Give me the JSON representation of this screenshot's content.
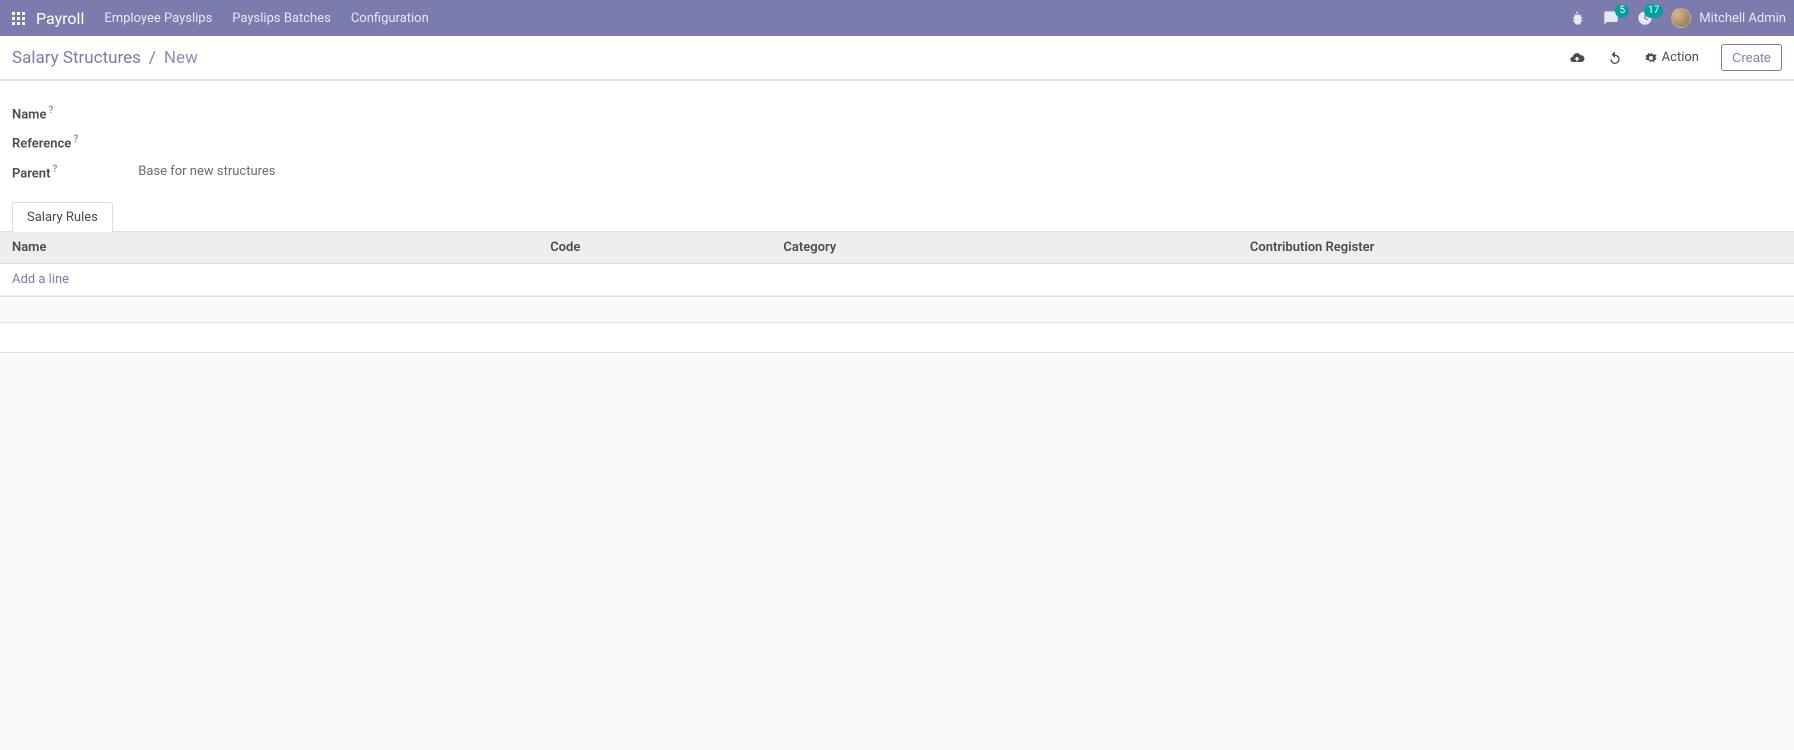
{
  "topnav": {
    "app_title": "Payroll",
    "links": [
      "Employee Payslips",
      "Payslips Batches",
      "Configuration"
    ],
    "messages_count": "5",
    "activities_count": "17",
    "username": "Mitchell Admin"
  },
  "control_panel": {
    "breadcrumb_root": "Salary Structures",
    "breadcrumb_sep": "/",
    "breadcrumb_current": "New",
    "action_label": "Action",
    "create_label": "Create"
  },
  "form": {
    "fields": {
      "name": {
        "label": "Name",
        "value": ""
      },
      "reference": {
        "label": "Reference",
        "value": ""
      },
      "parent": {
        "label": "Parent",
        "value": "Base for new structures"
      }
    },
    "help_glyph": "?",
    "tabs": {
      "salary_rules": "Salary Rules"
    },
    "table": {
      "headers": [
        "Name",
        "Code",
        "Category",
        "Contribution Register"
      ],
      "rows": [],
      "add_line_label": "Add a line"
    }
  }
}
